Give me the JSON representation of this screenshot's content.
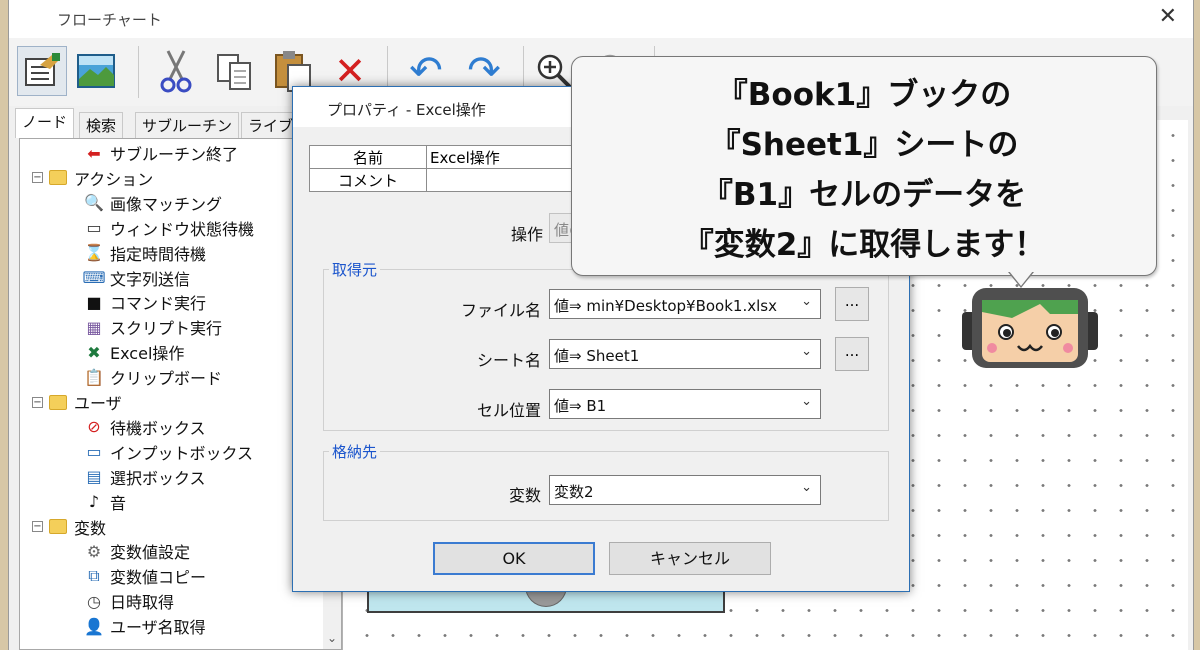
{
  "window": {
    "title": "フローチャート",
    "close": "✕"
  },
  "toolbar": {
    "icons": [
      "properties-icon",
      "image-icon",
      "cut-icon",
      "copy-icon",
      "paste-icon",
      "delete-icon",
      "undo-icon",
      "redo-icon",
      "zoom-in-icon",
      "zoom-out-icon"
    ]
  },
  "tabs": [
    "ノード",
    "検索",
    "サブルーチン",
    "ライブラ"
  ],
  "tree": {
    "items": [
      {
        "label": "サブルーチン終了",
        "icon": "⬅",
        "color": "#d42020"
      },
      {
        "label": "アクション",
        "folder": true
      },
      {
        "label": "画像マッチング",
        "icon": "🔍",
        "color": "#2a6db5"
      },
      {
        "label": "ウィンドウ状態待機",
        "icon": "▭",
        "color": "#3a3a3a"
      },
      {
        "label": "指定時間待機",
        "icon": "⌛",
        "color": "#8a6a3a"
      },
      {
        "label": "文字列送信",
        "icon": "⌨",
        "color": "#2a6db5"
      },
      {
        "label": "コマンド実行",
        "icon": "■",
        "color": "#111111"
      },
      {
        "label": "スクリプト実行",
        "icon": "▦",
        "color": "#7a5aa0"
      },
      {
        "label": "Excel操作",
        "icon": "✖",
        "color": "#1e7a3e"
      },
      {
        "label": "クリップボード",
        "icon": "📋",
        "color": "#b58a3a"
      },
      {
        "label": "ユーザ",
        "folder": true
      },
      {
        "label": "待機ボックス",
        "icon": "⊘",
        "color": "#d42020"
      },
      {
        "label": "インプットボックス",
        "icon": "▭",
        "color": "#2a6db5"
      },
      {
        "label": "選択ボックス",
        "icon": "▤",
        "color": "#2a6db5"
      },
      {
        "label": "音",
        "icon": "♪",
        "color": "#111111"
      },
      {
        "label": "変数",
        "folder": true
      },
      {
        "label": "変数値設定",
        "icon": "⚙",
        "color": "#666666"
      },
      {
        "label": "変数値コピー",
        "icon": "⧉",
        "color": "#2a6db5"
      },
      {
        "label": "日時取得",
        "icon": "◷",
        "color": "#444444"
      },
      {
        "label": "ユーザ名取得",
        "icon": "👤",
        "color": "#2a6db5"
      }
    ]
  },
  "dialog": {
    "title": "プロパティ - Excel操作",
    "name_label": "名前",
    "name_value": "Excel操作",
    "comment_label": "コメント",
    "comment_value": "",
    "operation_label": "操作",
    "operation_value": "値の取得",
    "source_group": "取得元",
    "file_label": "ファイル名",
    "file_value": "値⇒ min¥Desktop¥Book1.xlsx",
    "sheet_label": "シート名",
    "sheet_value": "値⇒ Sheet1",
    "cell_label": "セル位置",
    "cell_value": "値⇒ B1",
    "dest_group": "格納先",
    "var_label": "変数",
    "var_value": "変数2",
    "browse": "...",
    "ok": "OK",
    "cancel": "キャンセル"
  },
  "callout": {
    "lines": [
      "『Book1』ブックの",
      "『Sheet1』シートの",
      "『B1』セルのデータを",
      "『変数2』に取得します！"
    ]
  }
}
